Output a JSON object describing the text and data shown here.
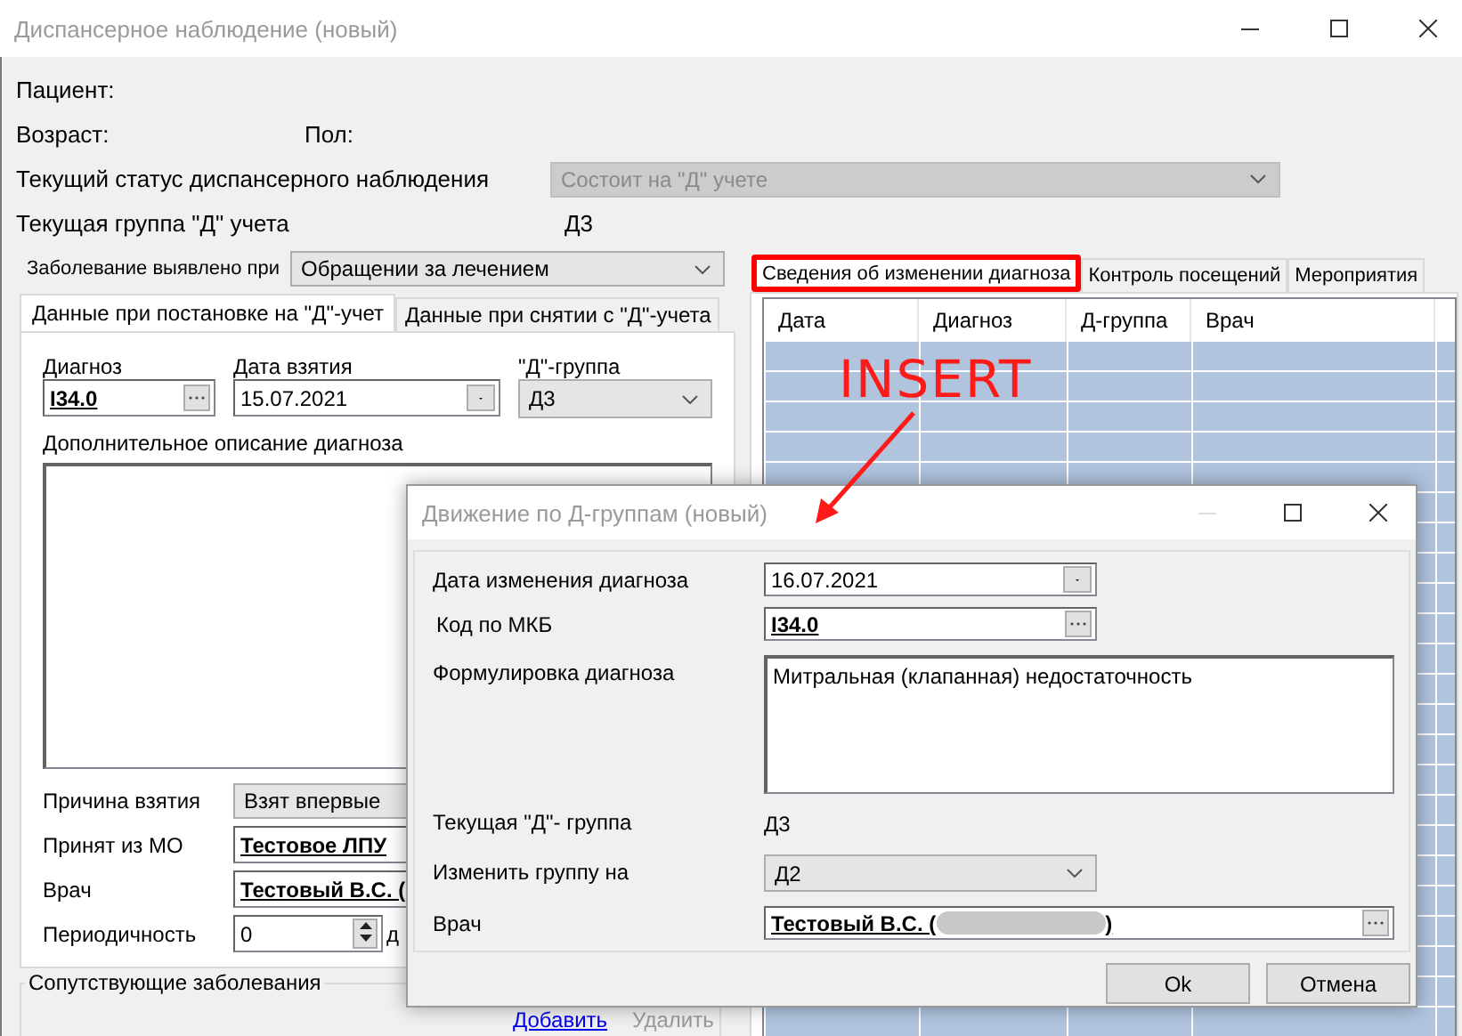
{
  "window": {
    "title": "Диспансерное наблюдение (новый)"
  },
  "patient": {
    "patient_label": "Пациент:",
    "age_label": "Возраст:",
    "sex_label": "Пол:",
    "status_label": "Текущий статус диспансерного наблюдения",
    "status_value": "Состоит на \"Д\" учете",
    "status_disabled": true,
    "group_label": "Текущая группа \"Д\" учета",
    "group_value": "Д3"
  },
  "detected": {
    "label": "Заболевание выявлено при",
    "value": "Обращении за лечением"
  },
  "left_tabs": [
    {
      "label": "Данные при постановке на \"Д\"-учет",
      "selected": true
    },
    {
      "label": "Данные при снятии с \"Д\"-учета",
      "selected": false
    }
  ],
  "registration": {
    "diagnosis_label": "Диагноз",
    "diagnosis": "I34.0",
    "date_label": "Дата взятия",
    "date": "15.07.2021",
    "group_label": "\"Д\"-группа",
    "group": "Д3",
    "description_label": "Дополнительное описание диагноза",
    "reason_label": "Причина взятия",
    "reason": "Взят впервые",
    "from_mo_label": "Принят из МО",
    "from_mo": "Тестовое ЛПУ",
    "doctor_label": "Врач",
    "doctor": "Тестовый В.С. (",
    "period_label": "Периодичность",
    "period": "0",
    "period_unit": "д"
  },
  "comorbid": {
    "title": "Сопутствующие заболевания",
    "add_link": "Добавить",
    "delete_link": {
      "label": "Удалить",
      "disabled": true
    }
  },
  "right_tabs": [
    {
      "label": "Сведения об изменении диагноза",
      "selected": true,
      "highlighted": true
    },
    {
      "label": "Контроль посещений",
      "selected": false,
      "highlighted": false
    },
    {
      "label": "Мероприятия",
      "selected": false,
      "highlighted": false
    }
  ],
  "history_table": {
    "columns": [
      "Дата",
      "Диагноз",
      "Д-группа",
      "Врач"
    ]
  },
  "annotation": {
    "text": "INSERT"
  },
  "dialog": {
    "title": "Движение по Д-группам (новый)",
    "fields": [
      {
        "kind": "date",
        "label": "Дата изменения диагноза",
        "value": "16.07.2021"
      },
      {
        "kind": "lookup",
        "label": "Код по МКБ",
        "value": "I34.0"
      },
      {
        "kind": "memo",
        "label": "Формулировка диагноза",
        "value": "Митральная (клапанная) недостаточность"
      },
      {
        "kind": "text",
        "label": "Текущая \"Д\"- группа",
        "value": "Д3"
      },
      {
        "kind": "combo",
        "label": "Изменить группу на",
        "value": "Д2"
      },
      {
        "kind": "person",
        "label": "Врач",
        "value": "Тестовый В.С. (",
        "value_end": ")"
      }
    ],
    "buttons": [
      "Ok",
      "Отмена"
    ]
  }
}
